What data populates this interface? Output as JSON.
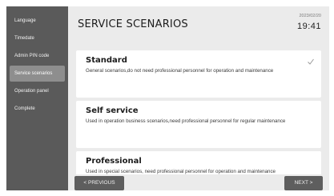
{
  "sidebar": {
    "items": [
      {
        "label": "Language"
      },
      {
        "label": "Timedate"
      },
      {
        "label": "Admin PIN code"
      },
      {
        "label": "Service scenarios"
      },
      {
        "label": "Operation panel"
      },
      {
        "label": "Complete"
      }
    ],
    "active_index": 3
  },
  "header": {
    "title": "SERVICE SCENARIOS",
    "date": "2023/02/20",
    "time": "19:41"
  },
  "scenarios": [
    {
      "title": "Standard",
      "description": "General scenarios,do not need professional personnel for operation and maintenance",
      "selected": true
    },
    {
      "title": "Self service",
      "description": "Used in operation business scenarios,need professional personnel for regular maintenance",
      "selected": false
    },
    {
      "title": "Professional",
      "description": "Used in special scenarios, need professional personnel for operation and maintenance",
      "selected": false
    }
  ],
  "footer": {
    "prev_label": "< PREVIOUS",
    "next_label": "NEXT >"
  },
  "icons": {
    "check": "checkmark-icon"
  },
  "colors": {
    "sidebar_bg": "#5a5a5a",
    "sidebar_active": "#8e8e8e",
    "panel_bg": "#ebebeb",
    "button_bg": "#5e5e5e"
  }
}
